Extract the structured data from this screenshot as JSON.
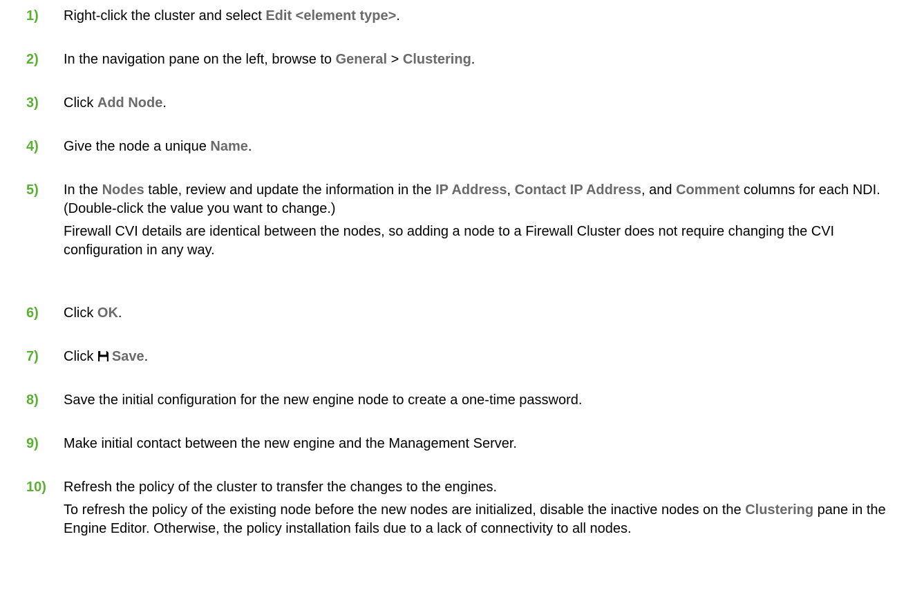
{
  "colors": {
    "step_number": "#5ab031",
    "ui_term": "#6a6a6a",
    "text": "#000000"
  },
  "steps": [
    {
      "num": "1)",
      "parts": [
        {
          "t": "Right-click the cluster and select "
        },
        {
          "t": "Edit <element type>",
          "ui": true
        },
        {
          "t": "."
        }
      ]
    },
    {
      "num": "2)",
      "parts": [
        {
          "t": "In the navigation pane on the left, browse to "
        },
        {
          "t": "General",
          "ui": true
        },
        {
          "t": " > "
        },
        {
          "t": "Clustering",
          "ui": true
        },
        {
          "t": "."
        }
      ]
    },
    {
      "num": "3)",
      "parts": [
        {
          "t": "Click "
        },
        {
          "t": "Add Node",
          "ui": true
        },
        {
          "t": "."
        }
      ]
    },
    {
      "num": "4)",
      "parts": [
        {
          "t": "Give the node a unique "
        },
        {
          "t": "Name",
          "ui": true
        },
        {
          "t": "."
        }
      ]
    },
    {
      "num": "5)",
      "parts": [
        {
          "t": "In the "
        },
        {
          "t": "Nodes",
          "ui": true
        },
        {
          "t": " table, review and update the information in the "
        },
        {
          "t": "IP Address",
          "ui": true
        },
        {
          "t": ", "
        },
        {
          "t": "Contact IP Address",
          "ui": true
        },
        {
          "t": ", and "
        },
        {
          "t": "Comment",
          "ui": true
        },
        {
          "t": " columns for each NDI. (Double-click the value you want to change.)"
        }
      ],
      "note": "Firewall CVI details are identical between the nodes, so adding a node to a Firewall Cluster does not require changing the CVI configuration in any way."
    },
    {
      "num": "6)",
      "parts": [
        {
          "t": "Click "
        },
        {
          "t": "OK",
          "ui": true
        },
        {
          "t": "."
        }
      ]
    },
    {
      "num": "7)",
      "parts": [
        {
          "t": "Click "
        },
        {
          "icon": "save-icon"
        },
        {
          "t": "Save",
          "ui": true
        },
        {
          "t": "."
        }
      ]
    },
    {
      "num": "8)",
      "parts": [
        {
          "t": "Save the initial configuration for the new engine node to create a one-time password."
        }
      ]
    },
    {
      "num": "9)",
      "parts": [
        {
          "t": "Make initial contact between the new engine and the Management Server."
        }
      ]
    },
    {
      "num": "10)",
      "parts": [
        {
          "t": "Refresh the policy of the cluster to transfer the changes to the engines."
        }
      ],
      "note_parts": [
        {
          "t": "To refresh the policy of the existing node before the new nodes are initialized, disable the inactive nodes on the "
        },
        {
          "t": "Clustering",
          "ui": true
        },
        {
          "t": " pane in the Engine Editor. Otherwise, the policy installation fails due to a lack of connectivity to all nodes."
        }
      ]
    }
  ]
}
